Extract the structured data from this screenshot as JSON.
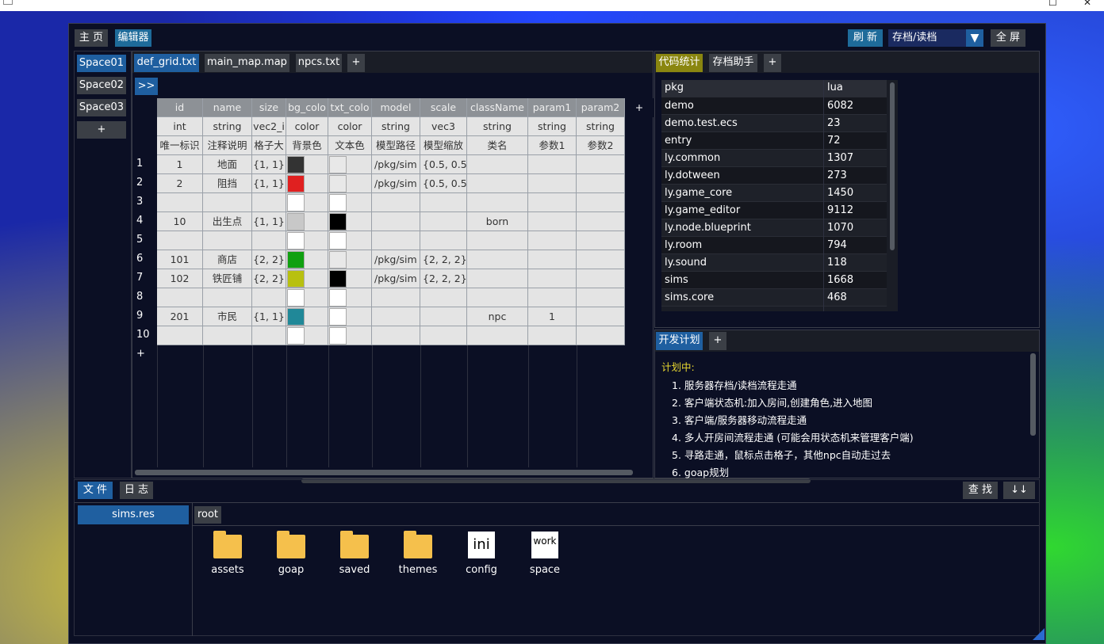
{
  "topbar": {
    "home": "主 页",
    "editor": "编辑器",
    "refresh": "刷 新",
    "save_load": "存档/读档",
    "fullscreen": "全 屏"
  },
  "spaces": [
    "Space01",
    "Space02",
    "Space03",
    "+"
  ],
  "file_tabs": [
    "def_grid.txt",
    "main_map.map",
    "npcs.txt",
    "+"
  ],
  "expand": ">>",
  "grid": {
    "columns": [
      "id",
      "name",
      "size",
      "bg_colo",
      "txt_colo",
      "model",
      "scale",
      "className",
      "param1",
      "param2"
    ],
    "types": [
      "int",
      "string",
      "vec2_i",
      "color",
      "color",
      "string",
      "vec3",
      "string",
      "string",
      "string"
    ],
    "descs": [
      "唯一标识",
      "注释说明",
      "格子大",
      "背景色",
      "文本色",
      "模型路径",
      "模型缩放",
      "类名",
      "参数1",
      "参数2"
    ],
    "add_col": "+",
    "rows": [
      {
        "n": "1",
        "id": "1",
        "name": "地面",
        "size": "{1, 1}",
        "bg": "#333333",
        "txt": "#e8e8e8",
        "model": "/pkg/sim",
        "scale": "{0.5, 0.5,",
        "cls": "",
        "p1": ""
      },
      {
        "n": "2",
        "id": "2",
        "name": "阻挡",
        "size": "{1, 1}",
        "bg": "#e02020",
        "txt": "#e8e8e8",
        "model": "/pkg/sim",
        "scale": "{0.5, 0.5,",
        "cls": "",
        "p1": ""
      },
      {
        "n": "3",
        "id": "",
        "name": "",
        "size": "",
        "bg": "#ffffff",
        "txt": "#ffffff",
        "model": "",
        "scale": "",
        "cls": "",
        "p1": ""
      },
      {
        "n": "4",
        "id": "10",
        "name": "出生点",
        "size": "{1, 1}",
        "bg": "#c8c8c8",
        "txt": "#000000",
        "model": "",
        "scale": "",
        "cls": "born",
        "p1": ""
      },
      {
        "n": "5",
        "id": "",
        "name": "",
        "size": "",
        "bg": "#ffffff",
        "txt": "#ffffff",
        "model": "",
        "scale": "",
        "cls": "",
        "p1": ""
      },
      {
        "n": "6",
        "id": "101",
        "name": "商店",
        "size": "{2, 2}",
        "bg": "#10a010",
        "txt": "#e8e8e8",
        "model": "/pkg/sim",
        "scale": "{2, 2, 2}",
        "cls": "",
        "p1": ""
      },
      {
        "n": "7",
        "id": "102",
        "name": "铁匠铺",
        "size": "{2, 2}",
        "bg": "#b8c010",
        "txt": "#000000",
        "model": "/pkg/sim",
        "scale": "{2, 2, 2}",
        "cls": "",
        "p1": ""
      },
      {
        "n": "8",
        "id": "",
        "name": "",
        "size": "",
        "bg": "#ffffff",
        "txt": "#ffffff",
        "model": "",
        "scale": "",
        "cls": "",
        "p1": ""
      },
      {
        "n": "9",
        "id": "201",
        "name": "市民",
        "size": "{1, 1}",
        "bg": "#208898",
        "txt": "#ffffff",
        "model": "",
        "scale": "",
        "cls": "npc",
        "p1": "1"
      },
      {
        "n": "10",
        "id": "",
        "name": "",
        "size": "",
        "bg": "#ffffff",
        "txt": "#ffffff",
        "model": "",
        "scale": "",
        "cls": "",
        "p1": ""
      }
    ],
    "add_row": "+"
  },
  "stats": {
    "tabs": [
      "代码统计",
      "存档助手",
      "+"
    ],
    "header": [
      "pkg",
      "lua"
    ],
    "rows": [
      [
        "demo",
        "6082"
      ],
      [
        "demo.test.ecs",
        "23"
      ],
      [
        "entry",
        "72"
      ],
      [
        "ly.common",
        "1307"
      ],
      [
        "ly.dotween",
        "273"
      ],
      [
        "ly.game_core",
        "1450"
      ],
      [
        "ly.game_editor",
        "9112"
      ],
      [
        "ly.node.blueprint",
        "1070"
      ],
      [
        "ly.room",
        "794"
      ],
      [
        "ly.sound",
        "118"
      ],
      [
        "sims",
        "1668"
      ],
      [
        "sims.core",
        "468"
      ]
    ]
  },
  "plan": {
    "tabs": [
      "开发计划",
      "+"
    ],
    "heading": "计划中:",
    "items": [
      "1. 服务器存档/读档流程走通",
      "2. 客户端状态机:加入房间,创建角色,进入地图",
      "3. 客户端/服务器移动流程走通",
      "4. 多人开房间流程走通 (可能会用状态机来管理客户端)",
      "5. 寻路走通，鼠标点击格子，其他npc自动走过去",
      "6. goap规划"
    ]
  },
  "bottom": {
    "tabs": [
      "文 件",
      "日 志"
    ],
    "find": "查 找",
    "sort": "↓↓",
    "package": "sims.res",
    "path": "root",
    "items": [
      {
        "name": "assets",
        "type": "folder"
      },
      {
        "name": "goap",
        "type": "folder"
      },
      {
        "name": "saved",
        "type": "folder"
      },
      {
        "name": "themes",
        "type": "folder"
      },
      {
        "name": "config",
        "type": "ini",
        "glyph": "ini"
      },
      {
        "name": "space",
        "type": "work",
        "glyph": "work"
      }
    ]
  }
}
